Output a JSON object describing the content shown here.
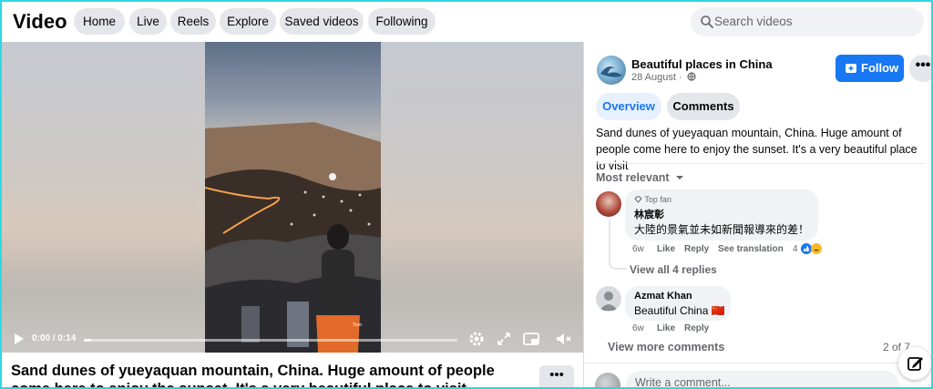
{
  "header": {
    "title": "Video",
    "nav": [
      {
        "label": "Home"
      },
      {
        "label": "Live"
      },
      {
        "label": "Reels"
      },
      {
        "label": "Explore"
      },
      {
        "label": "Saved videos"
      },
      {
        "label": "Following"
      }
    ],
    "search_placeholder": "Search videos"
  },
  "player": {
    "time": "0:00 / 0:14",
    "progress_fraction": 0.02,
    "icons": [
      "play-icon",
      "settings-icon",
      "expand-icon",
      "picture-in-picture-icon",
      "mute-icon"
    ]
  },
  "post": {
    "caption": "Sand dunes of yueyaquan mountain, China. Huge amount of people come here to enjoy the sunset. It's a very beautiful place to visit",
    "more_label": "•••"
  },
  "panel": {
    "page_name": "Beautiful places in China",
    "date": "28 August ·",
    "follow_label": "Follow",
    "more_label": "•••",
    "tabs": [
      {
        "label": "Overview",
        "active": true
      },
      {
        "label": "Comments",
        "active": false
      }
    ],
    "description": "Sand dunes of yueyaquan mountain, China. Huge amount of people come here to enjoy the sunset. It's a very beautiful place to visit",
    "sort_label": "Most relevant",
    "comments": [
      {
        "badge": "Top fan",
        "name": "林宸彰",
        "text": "大陸的景氣並未如新聞報導來的差！",
        "time": "6w",
        "like": "Like",
        "reply": "Reply",
        "see_translation": "See translation",
        "reaction_count": "4",
        "view_replies": "View all 4 replies"
      },
      {
        "name": "Azmat Khan",
        "text": "Beautiful China 🇨🇳",
        "time": "6w",
        "like": "Like",
        "reply": "Reply"
      }
    ],
    "view_more": "View more comments",
    "count": "2 of 7",
    "composer_placeholder": "Write a comment..."
  },
  "colors": {
    "accent": "#1877f2",
    "pill_bg": "#e4e6eb",
    "muted_text": "#65676b",
    "frame_border": "#2fd8e0"
  }
}
